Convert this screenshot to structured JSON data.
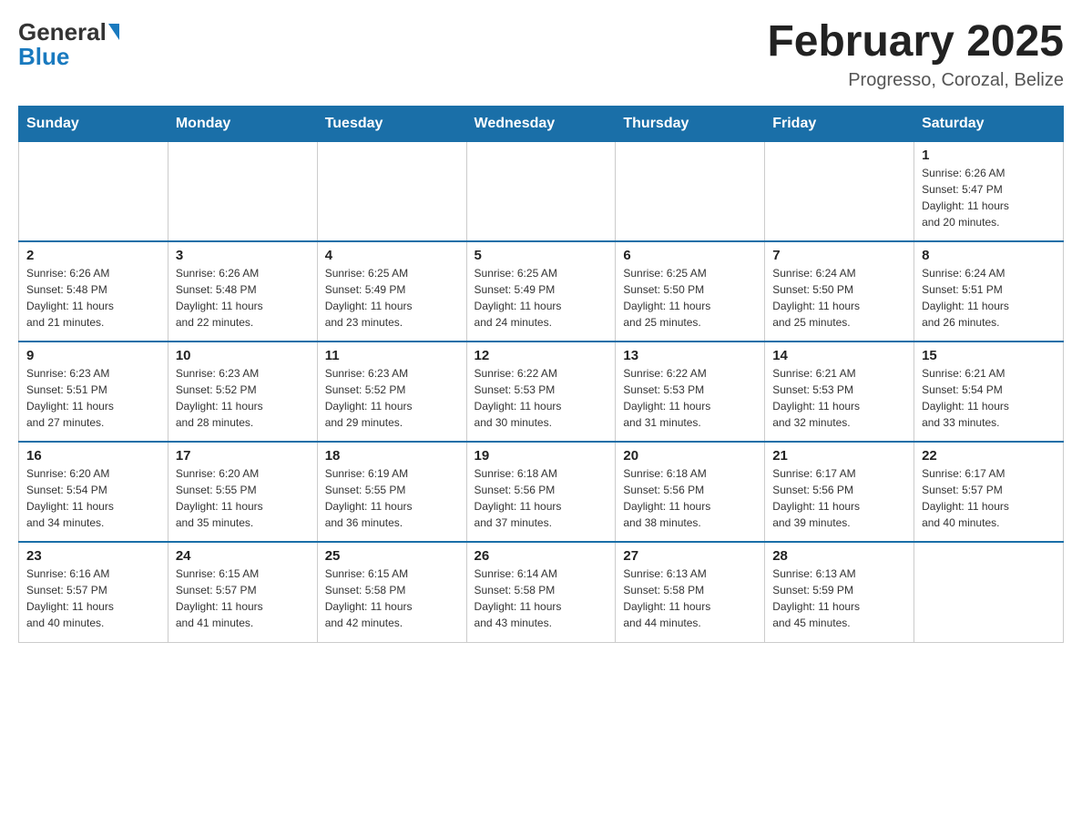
{
  "header": {
    "logo_general": "General",
    "logo_blue": "Blue",
    "month_title": "February 2025",
    "location": "Progresso, Corozal, Belize"
  },
  "days_of_week": [
    "Sunday",
    "Monday",
    "Tuesday",
    "Wednesday",
    "Thursday",
    "Friday",
    "Saturday"
  ],
  "weeks": [
    [
      {
        "day": "",
        "info": ""
      },
      {
        "day": "",
        "info": ""
      },
      {
        "day": "",
        "info": ""
      },
      {
        "day": "",
        "info": ""
      },
      {
        "day": "",
        "info": ""
      },
      {
        "day": "",
        "info": ""
      },
      {
        "day": "1",
        "info": "Sunrise: 6:26 AM\nSunset: 5:47 PM\nDaylight: 11 hours\nand 20 minutes."
      }
    ],
    [
      {
        "day": "2",
        "info": "Sunrise: 6:26 AM\nSunset: 5:48 PM\nDaylight: 11 hours\nand 21 minutes."
      },
      {
        "day": "3",
        "info": "Sunrise: 6:26 AM\nSunset: 5:48 PM\nDaylight: 11 hours\nand 22 minutes."
      },
      {
        "day": "4",
        "info": "Sunrise: 6:25 AM\nSunset: 5:49 PM\nDaylight: 11 hours\nand 23 minutes."
      },
      {
        "day": "5",
        "info": "Sunrise: 6:25 AM\nSunset: 5:49 PM\nDaylight: 11 hours\nand 24 minutes."
      },
      {
        "day": "6",
        "info": "Sunrise: 6:25 AM\nSunset: 5:50 PM\nDaylight: 11 hours\nand 25 minutes."
      },
      {
        "day": "7",
        "info": "Sunrise: 6:24 AM\nSunset: 5:50 PM\nDaylight: 11 hours\nand 25 minutes."
      },
      {
        "day": "8",
        "info": "Sunrise: 6:24 AM\nSunset: 5:51 PM\nDaylight: 11 hours\nand 26 minutes."
      }
    ],
    [
      {
        "day": "9",
        "info": "Sunrise: 6:23 AM\nSunset: 5:51 PM\nDaylight: 11 hours\nand 27 minutes."
      },
      {
        "day": "10",
        "info": "Sunrise: 6:23 AM\nSunset: 5:52 PM\nDaylight: 11 hours\nand 28 minutes."
      },
      {
        "day": "11",
        "info": "Sunrise: 6:23 AM\nSunset: 5:52 PM\nDaylight: 11 hours\nand 29 minutes."
      },
      {
        "day": "12",
        "info": "Sunrise: 6:22 AM\nSunset: 5:53 PM\nDaylight: 11 hours\nand 30 minutes."
      },
      {
        "day": "13",
        "info": "Sunrise: 6:22 AM\nSunset: 5:53 PM\nDaylight: 11 hours\nand 31 minutes."
      },
      {
        "day": "14",
        "info": "Sunrise: 6:21 AM\nSunset: 5:53 PM\nDaylight: 11 hours\nand 32 minutes."
      },
      {
        "day": "15",
        "info": "Sunrise: 6:21 AM\nSunset: 5:54 PM\nDaylight: 11 hours\nand 33 minutes."
      }
    ],
    [
      {
        "day": "16",
        "info": "Sunrise: 6:20 AM\nSunset: 5:54 PM\nDaylight: 11 hours\nand 34 minutes."
      },
      {
        "day": "17",
        "info": "Sunrise: 6:20 AM\nSunset: 5:55 PM\nDaylight: 11 hours\nand 35 minutes."
      },
      {
        "day": "18",
        "info": "Sunrise: 6:19 AM\nSunset: 5:55 PM\nDaylight: 11 hours\nand 36 minutes."
      },
      {
        "day": "19",
        "info": "Sunrise: 6:18 AM\nSunset: 5:56 PM\nDaylight: 11 hours\nand 37 minutes."
      },
      {
        "day": "20",
        "info": "Sunrise: 6:18 AM\nSunset: 5:56 PM\nDaylight: 11 hours\nand 38 minutes."
      },
      {
        "day": "21",
        "info": "Sunrise: 6:17 AM\nSunset: 5:56 PM\nDaylight: 11 hours\nand 39 minutes."
      },
      {
        "day": "22",
        "info": "Sunrise: 6:17 AM\nSunset: 5:57 PM\nDaylight: 11 hours\nand 40 minutes."
      }
    ],
    [
      {
        "day": "23",
        "info": "Sunrise: 6:16 AM\nSunset: 5:57 PM\nDaylight: 11 hours\nand 40 minutes."
      },
      {
        "day": "24",
        "info": "Sunrise: 6:15 AM\nSunset: 5:57 PM\nDaylight: 11 hours\nand 41 minutes."
      },
      {
        "day": "25",
        "info": "Sunrise: 6:15 AM\nSunset: 5:58 PM\nDaylight: 11 hours\nand 42 minutes."
      },
      {
        "day": "26",
        "info": "Sunrise: 6:14 AM\nSunset: 5:58 PM\nDaylight: 11 hours\nand 43 minutes."
      },
      {
        "day": "27",
        "info": "Sunrise: 6:13 AM\nSunset: 5:58 PM\nDaylight: 11 hours\nand 44 minutes."
      },
      {
        "day": "28",
        "info": "Sunrise: 6:13 AM\nSunset: 5:59 PM\nDaylight: 11 hours\nand 45 minutes."
      },
      {
        "day": "",
        "info": ""
      }
    ]
  ]
}
